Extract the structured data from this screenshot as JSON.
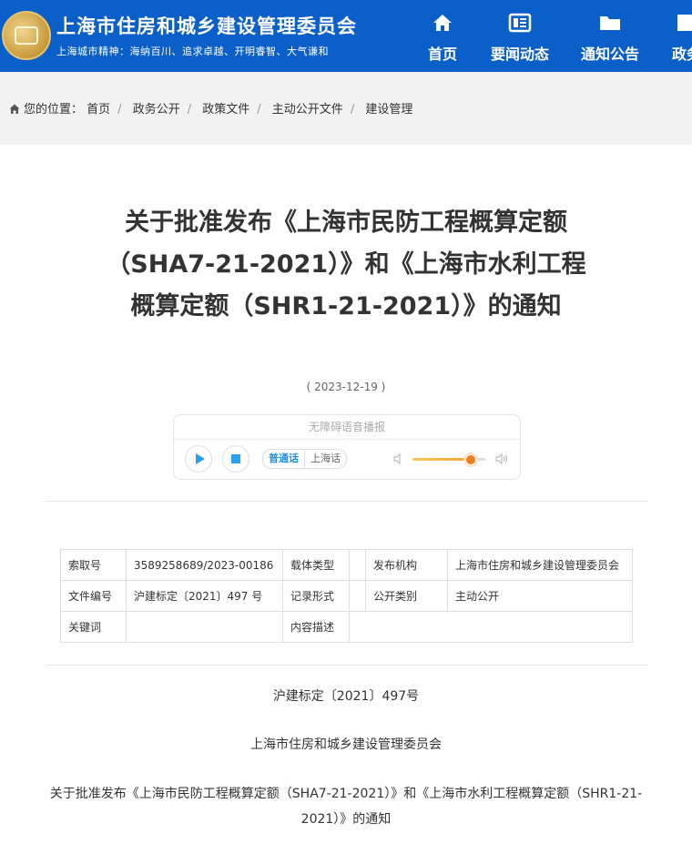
{
  "header": {
    "site_title": "上海市住房和城乡建设管理委员会",
    "slogan": "上海城市精神：海纳百川、追求卓越、开明睿智、大气谦和",
    "nav": [
      {
        "label": "首页",
        "icon": "home-icon"
      },
      {
        "label": "要闻动态",
        "icon": "newspaper-icon"
      },
      {
        "label": "通知公告",
        "icon": "folder-icon"
      },
      {
        "label": "政务",
        "icon": "document-icon"
      }
    ],
    "colors": {
      "bar": "#0a60c8",
      "text": "#ffffff"
    }
  },
  "breadcrumb": {
    "prefix": "您的位置：",
    "items": [
      "首页",
      "政务公开",
      "政策文件",
      "主动公开文件",
      "建设管理"
    ]
  },
  "article": {
    "title": "关于批准发布《上海市民防工程概算定额（SHA7-21-2021）》和《上海市水利工程概算定额（SHR1-21-2021）》的通知",
    "date": "( 2023-12-19 )"
  },
  "player": {
    "header": "无障碍语音播报",
    "lang_active": "普通话",
    "lang_other": "上海话",
    "volume_level": 0.8,
    "accent": "#2a9ef0"
  },
  "meta_table": {
    "rows": [
      [
        {
          "label": "索取号",
          "value": "3589258689/2023-00186"
        },
        {
          "label": "载体类型",
          "value": ""
        },
        {
          "label": "发布机构",
          "value": "上海市住房和城乡建设管理委员会"
        }
      ],
      [
        {
          "label": "文件编号",
          "value": "沪建标定〔2021〕497 号"
        },
        {
          "label": "记录形式",
          "value": ""
        },
        {
          "label": "公开类别",
          "value": "主动公开"
        }
      ]
    ],
    "last_row": {
      "keyword_label": "关键词",
      "keyword_value": "",
      "desc_label": "内容描述",
      "desc_value": ""
    }
  },
  "body": {
    "doc_no": "沪建标定〔2021〕497号",
    "issuer": "上海市住房和城乡建设管理委员会",
    "subject": "关于批准发布《上海市民防工程概算定额（SHA7-21-2021）》和《上海市水利工程概算定额（SHR1-21-2021）》的通知"
  }
}
